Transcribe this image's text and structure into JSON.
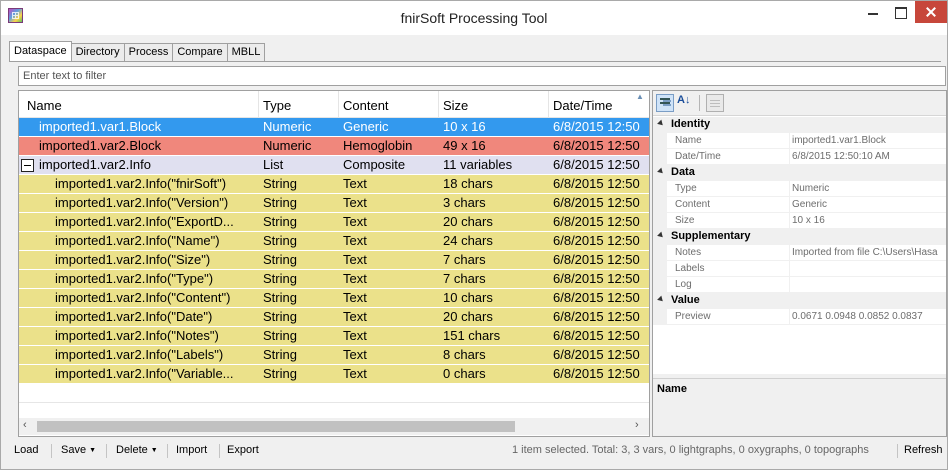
{
  "window": {
    "title": "fnirSoft Processing Tool"
  },
  "tabs": [
    "Dataspace",
    "Directory",
    "Process",
    "Compare",
    "MBLL"
  ],
  "filter": {
    "placeholder": "Enter text to filter",
    "value": ""
  },
  "grid": {
    "columns": [
      "Name",
      "Type",
      "Content",
      "Size",
      "Date/Time"
    ],
    "rows": [
      {
        "name": "imported1.var1.Block",
        "type": "Numeric",
        "content": "Generic",
        "size": "10 x 16",
        "date": "6/8/2015 12:50",
        "style": "sel",
        "indent": 1
      },
      {
        "name": "imported1.var2.Block",
        "type": "Numeric",
        "content": "Hemoglobin",
        "size": "49 x 16",
        "date": "6/8/2015 12:50",
        "style": "hemo",
        "indent": 1
      },
      {
        "name": "imported1.var2.Info",
        "type": "List",
        "content": "Composite",
        "size": "11 variables",
        "date": "6/8/2015 12:50",
        "style": "list",
        "indent": 0,
        "expander": true
      },
      {
        "name": "imported1.var2.Info(\"fnirSoft\")",
        "type": "String",
        "content": "Text",
        "size": "18 chars",
        "date": "6/8/2015 12:50",
        "style": "child",
        "indent": 2
      },
      {
        "name": "imported1.var2.Info(\"Version\")",
        "type": "String",
        "content": "Text",
        "size": "3 chars",
        "date": "6/8/2015 12:50",
        "style": "child",
        "indent": 2
      },
      {
        "name": "imported1.var2.Info(\"ExportD...",
        "type": "String",
        "content": "Text",
        "size": "20 chars",
        "date": "6/8/2015 12:50",
        "style": "child",
        "indent": 2
      },
      {
        "name": "imported1.var2.Info(\"Name\")",
        "type": "String",
        "content": "Text",
        "size": "24 chars",
        "date": "6/8/2015 12:50",
        "style": "child",
        "indent": 2
      },
      {
        "name": "imported1.var2.Info(\"Size\")",
        "type": "String",
        "content": "Text",
        "size": "7 chars",
        "date": "6/8/2015 12:50",
        "style": "child",
        "indent": 2
      },
      {
        "name": "imported1.var2.Info(\"Type\")",
        "type": "String",
        "content": "Text",
        "size": "7 chars",
        "date": "6/8/2015 12:50",
        "style": "child",
        "indent": 2
      },
      {
        "name": "imported1.var2.Info(\"Content\")",
        "type": "String",
        "content": "Text",
        "size": "10 chars",
        "date": "6/8/2015 12:50",
        "style": "child",
        "indent": 2
      },
      {
        "name": "imported1.var2.Info(\"Date\")",
        "type": "String",
        "content": "Text",
        "size": "20 chars",
        "date": "6/8/2015 12:50",
        "style": "child",
        "indent": 2
      },
      {
        "name": "imported1.var2.Info(\"Notes\")",
        "type": "String",
        "content": "Text",
        "size": "151 chars",
        "date": "6/8/2015 12:50",
        "style": "child",
        "indent": 2
      },
      {
        "name": "imported1.var2.Info(\"Labels\")",
        "type": "String",
        "content": "Text",
        "size": "8 chars",
        "date": "6/8/2015 12:50",
        "style": "child",
        "indent": 2
      },
      {
        "name": "imported1.var2.Info(\"Variable...",
        "type": "String",
        "content": "Text",
        "size": "0 chars",
        "date": "6/8/2015 12:50",
        "style": "child",
        "indent": 2
      }
    ]
  },
  "properties": {
    "categories": [
      {
        "label": "Identity",
        "items": [
          {
            "key": "Name",
            "value": "imported1.var1.Block"
          },
          {
            "key": "Date/Time",
            "value": "6/8/2015 12:50:10 AM"
          }
        ]
      },
      {
        "label": "Data",
        "items": [
          {
            "key": "Type",
            "value": "Numeric"
          },
          {
            "key": "Content",
            "value": "Generic"
          },
          {
            "key": "Size",
            "value": "10 x 16"
          }
        ]
      },
      {
        "label": "Supplementary",
        "items": [
          {
            "key": "Notes",
            "value": "Imported from file C:\\Users\\Hasa"
          },
          {
            "key": "Labels",
            "value": ""
          },
          {
            "key": "Log",
            "value": ""
          }
        ]
      },
      {
        "label": "Value",
        "items": [
          {
            "key": "Preview",
            "value": "0.0671  0.0948  0.0852  0.0837"
          }
        ]
      }
    ],
    "description_title": "Name"
  },
  "statusbar": {
    "load": "Load",
    "save": "Save",
    "delete": "Delete",
    "import": "Import",
    "export": "Export",
    "status": "1 item selected. Total: 3, 3 vars, 0 lightgraphs, 0 oxygraphs, 0 topographs",
    "refresh": "Refresh"
  },
  "icons": {
    "app": "app-icon",
    "categorized": "categorized-view-icon",
    "alphabetical": "sort-alphabetical-icon",
    "property_pages": "property-pages-icon"
  }
}
